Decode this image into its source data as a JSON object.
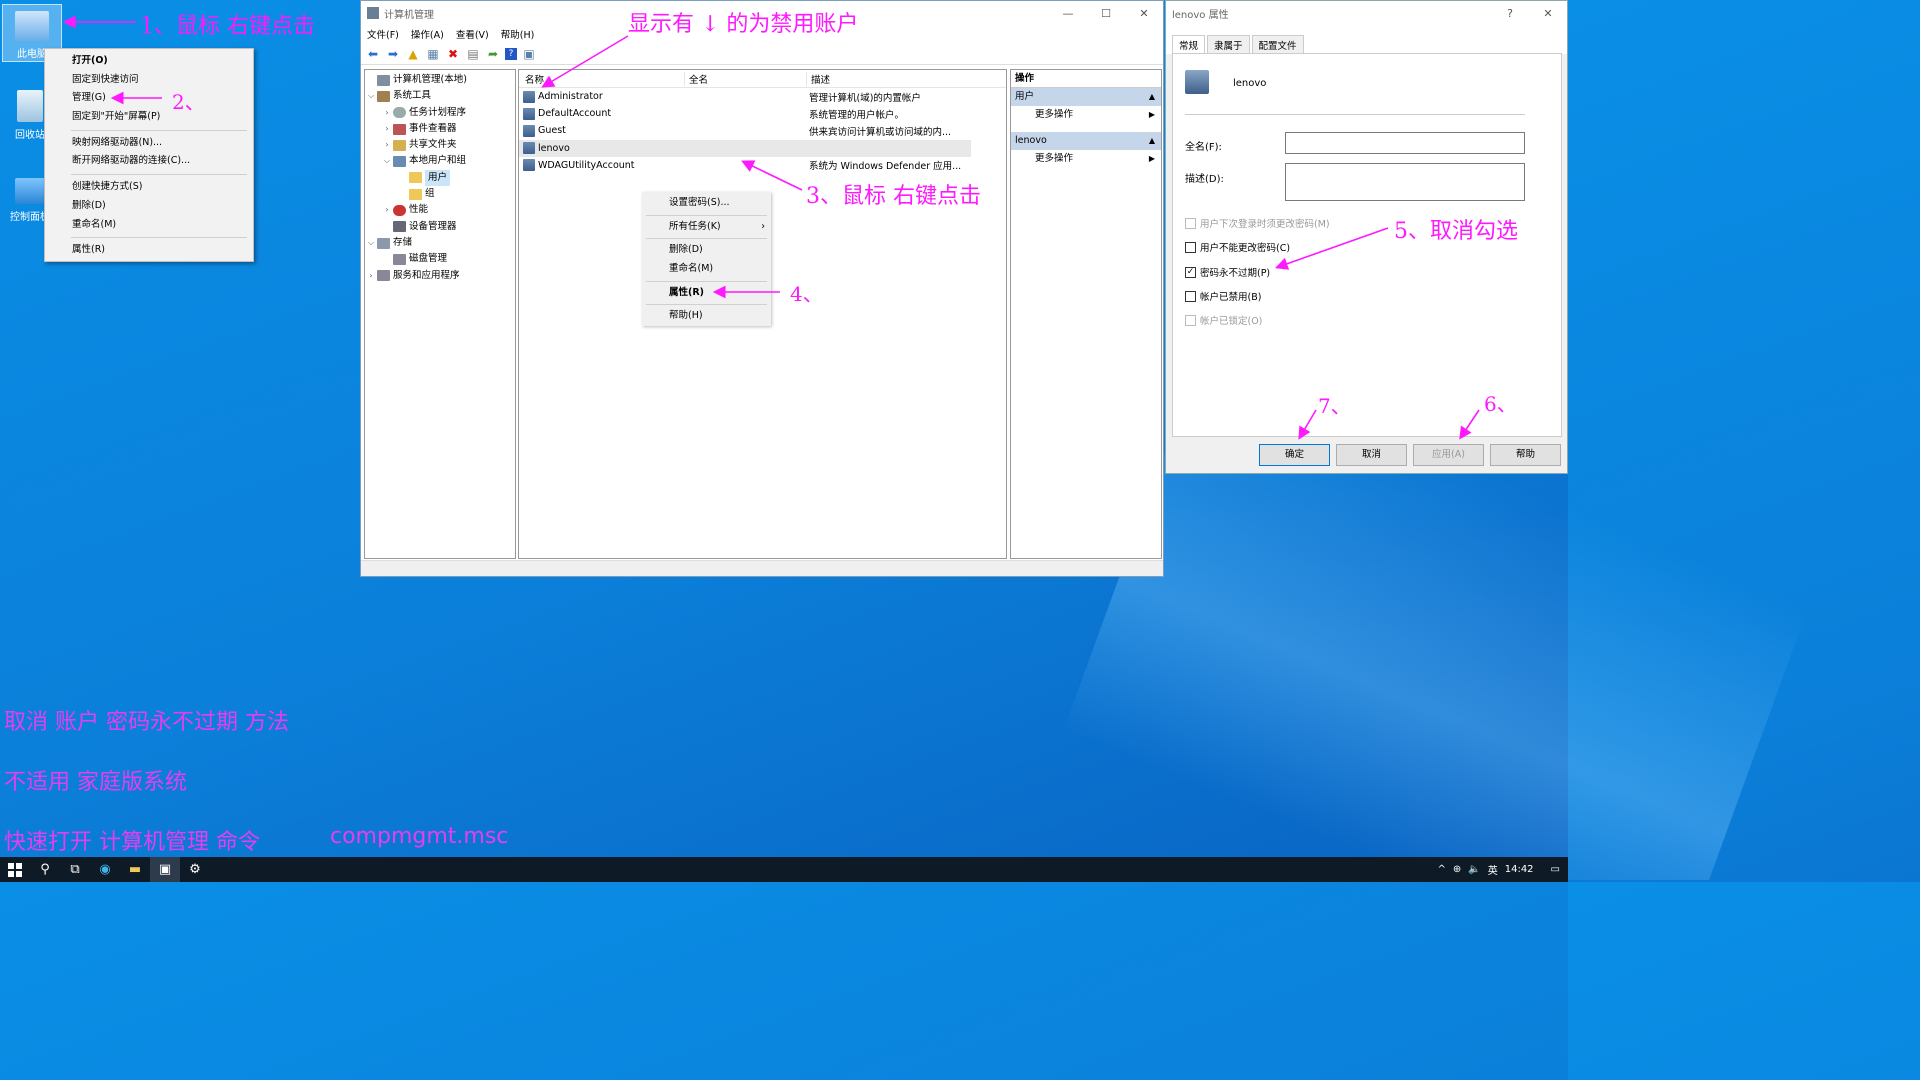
{
  "desktop": {
    "icons": [
      "此电脑",
      "回收站",
      "控制面板"
    ]
  },
  "context_menu_desktop": {
    "items": [
      "打开(O)",
      "固定到快速访问",
      "管理(G)",
      "固定到\"开始\"屏幕(P)",
      "映射网络驱动器(N)...",
      "断开网络驱动器的连接(C)...",
      "创建快捷方式(S)",
      "删除(D)",
      "重命名(M)",
      "属性(R)"
    ]
  },
  "mmc": {
    "title": "计算机管理",
    "menu": [
      "文件(F)",
      "操作(A)",
      "查看(V)",
      "帮助(H)"
    ],
    "tree": {
      "root": "计算机管理(本地)",
      "system_tools": "系统工具",
      "task_scheduler": "任务计划程序",
      "event_viewer": "事件查看器",
      "shared_folders": "共享文件夹",
      "local_users": "本地用户和组",
      "users": "用户",
      "groups": "组",
      "performance": "性能",
      "device_manager": "设备管理器",
      "storage": "存储",
      "disk_mgmt": "磁盘管理",
      "services": "服务和应用程序"
    },
    "columns": [
      "名称",
      "全名",
      "描述"
    ],
    "rows": [
      {
        "name": "Administrator",
        "fullname": "",
        "desc": "管理计算机(域)的内置帐户"
      },
      {
        "name": "DefaultAccount",
        "fullname": "",
        "desc": "系统管理的用户帐户。"
      },
      {
        "name": "Guest",
        "fullname": "",
        "desc": "供来宾访问计算机或访问域的内..."
      },
      {
        "name": "lenovo",
        "fullname": "",
        "desc": ""
      },
      {
        "name": "WDAGUtilityAccount",
        "fullname": "",
        "desc": "系统为 Windows Defender 应用..."
      }
    ],
    "actions": {
      "header": "操作",
      "section1": "用户",
      "more1": "更多操作",
      "section2": "lenovo",
      "more2": "更多操作"
    }
  },
  "context_menu_user": {
    "items": [
      "设置密码(S)...",
      "所有任务(K)",
      "删除(D)",
      "重命名(M)",
      "属性(R)",
      "帮助(H)"
    ]
  },
  "dialog": {
    "title": "lenovo 属性",
    "help": "?",
    "close": "✕",
    "tabs": [
      "常规",
      "隶属于",
      "配置文件"
    ],
    "username": "lenovo",
    "fullname_label": "全名(F):",
    "fullname_value": "",
    "desc_label": "描述(D):",
    "desc_value": "",
    "checks": [
      {
        "label": "用户下次登录时须更改密码(M)",
        "checked": false,
        "disabled": true
      },
      {
        "label": "用户不能更改密码(C)",
        "checked": false,
        "disabled": false
      },
      {
        "label": "密码永不过期(P)",
        "checked": true,
        "disabled": false
      },
      {
        "label": "帐户已禁用(B)",
        "checked": false,
        "disabled": false
      },
      {
        "label": "帐户已锁定(O)",
        "checked": false,
        "disabled": true
      }
    ],
    "buttons": {
      "ok": "确定",
      "cancel": "取消",
      "apply": "应用(A)",
      "help": "帮助"
    }
  },
  "annotations": {
    "a1": "1、鼠标 右键点击",
    "a2": "2、",
    "a_top": "显示有 ↓ 的为禁用账户",
    "a3": "3、鼠标 右键点击",
    "a4": "4、",
    "a5": "5、取消勾选",
    "a6": "6、",
    "a7": "7、"
  },
  "notes": {
    "n1": "取消 账户  密码永不过期 方法",
    "n2": "不适用 家庭版系统",
    "n3": "快速打开 计算机管理 命令",
    "n3cmd": "compmgmt.msc"
  },
  "taskbar": {
    "ime": "英",
    "time": "14:42"
  }
}
